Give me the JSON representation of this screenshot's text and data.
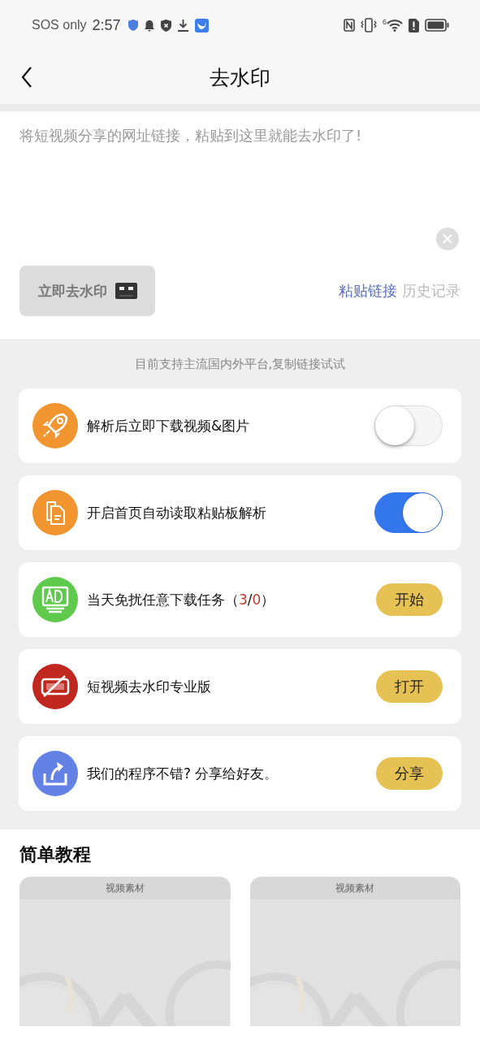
{
  "status_bar": {
    "carrier": "SOS only",
    "time": "2:57",
    "network_badge": "6"
  },
  "header": {
    "title": "去水印"
  },
  "input": {
    "placeholder": "将短视频分享的网址链接，粘贴到这里就能去水印了!",
    "submit": "立即去水印",
    "paste": "粘贴链接",
    "history": "历史记录"
  },
  "hint": "目前支持主流国内外平台,复制链接试试",
  "settings": [
    {
      "kind": "toggle",
      "color": "#f0952f",
      "label": [
        {
          "text": "解析后立即下载视频&图片"
        }
      ],
      "on": false
    },
    {
      "kind": "toggle",
      "color": "#f0952f",
      "label": [
        {
          "text": "开启首页自动读取粘贴板解析"
        }
      ],
      "on": true
    },
    {
      "kind": "button",
      "color": "#5ec94a",
      "label": [
        {
          "text": "当天免扰任意下载任务（"
        },
        {
          "text": "3",
          "highlight": true
        },
        {
          "text": "/"
        },
        {
          "text": "0",
          "highlight": true
        },
        {
          "text": "）"
        }
      ],
      "button": "开始"
    },
    {
      "kind": "button",
      "color": "#c0281f",
      "label": [
        {
          "text": "短视频去水印专业版"
        }
      ],
      "button": "打开"
    },
    {
      "kind": "button",
      "color": "#6482e6",
      "label": [
        {
          "text": "我们的程序不错? 分享给好友。"
        }
      ],
      "button": "分享"
    }
  ],
  "tutorial": {
    "title": "简单教程",
    "cards": [
      {
        "label": "视频素材",
        "kind": "picture"
      },
      {
        "label": "视频素材",
        "kind": "picture"
      }
    ]
  }
}
